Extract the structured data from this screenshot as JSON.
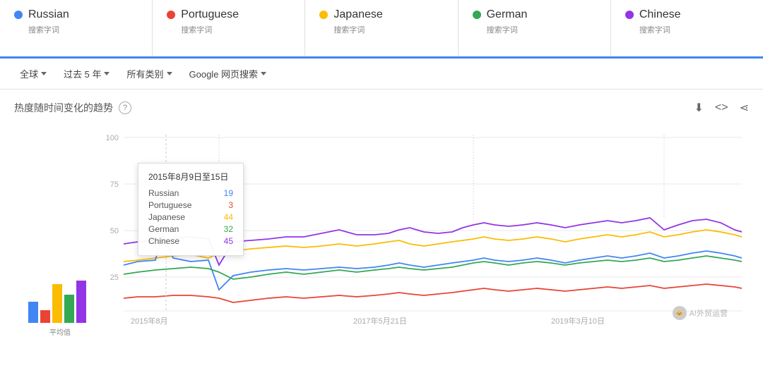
{
  "legend": {
    "items": [
      {
        "id": "russian",
        "label": "Russian",
        "sub": "搜索字词",
        "color": "#4285f4"
      },
      {
        "id": "portuguese",
        "label": "Portuguese",
        "sub": "搜索字词",
        "color": "#ea4335"
      },
      {
        "id": "japanese",
        "label": "Japanese",
        "sub": "搜索字词",
        "color": "#fbbc04"
      },
      {
        "id": "german",
        "label": "German",
        "sub": "搜索字词",
        "color": "#34a853"
      },
      {
        "id": "chinese",
        "label": "Chinese",
        "sub": "搜索字词",
        "color": "#9334e6"
      }
    ]
  },
  "filters": [
    {
      "id": "region",
      "label": "全球"
    },
    {
      "id": "period",
      "label": "过去 5 年"
    },
    {
      "id": "category",
      "label": "所有类别"
    },
    {
      "id": "search-type",
      "label": "Google 网页搜索"
    }
  ],
  "chart": {
    "title": "热度随时间变化的趋势",
    "help_label": "?",
    "download_icon": "⬇",
    "embed_icon": "<>",
    "share_icon": "⋖"
  },
  "tooltip": {
    "date": "2015年8月9日至15日",
    "rows": [
      {
        "label": "Russian",
        "value": "19",
        "color": "#4285f4"
      },
      {
        "label": "Portuguese",
        "value": "3",
        "color": "#ea4335"
      },
      {
        "label": "Japanese",
        "value": "44",
        "color": "#fbbc04"
      },
      {
        "label": "German",
        "value": "32",
        "color": "#34a853"
      },
      {
        "label": "Chinese",
        "value": "45",
        "color": "#9334e6"
      }
    ]
  },
  "x_axis": {
    "labels": [
      "2015年8月",
      "2017年5月21日",
      "2019年3月10日"
    ]
  },
  "y_axis": {
    "labels": [
      "100",
      "75",
      "50",
      "25"
    ]
  },
  "avg_label": "平均值",
  "bars": [
    {
      "color": "#4285f4",
      "height": 30
    },
    {
      "color": "#ea4335",
      "height": 18
    },
    {
      "color": "#fbbc04",
      "height": 55
    },
    {
      "color": "#34a853",
      "height": 40
    },
    {
      "color": "#9334e6",
      "height": 60
    }
  ],
  "watermark": "A!外贸运营"
}
